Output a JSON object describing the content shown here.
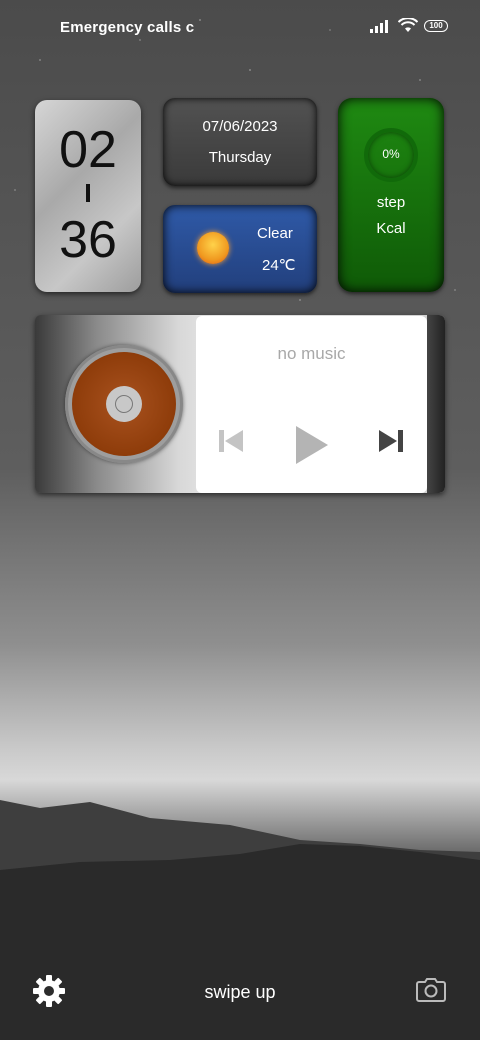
{
  "status_bar": {
    "carrier_text": "Emergency calls c",
    "battery_level": "100",
    "icons": [
      "signal-icon",
      "wifi-icon",
      "battery-icon"
    ]
  },
  "clock_widget": {
    "hours": "02",
    "minutes": "36"
  },
  "date_widget": {
    "date": "07/06/2023",
    "weekday": "Thursday"
  },
  "weather_widget": {
    "condition": "Clear",
    "temperature": "24℃",
    "icon": "sun-icon"
  },
  "fitness_widget": {
    "progress_label": "0%",
    "progress_value": 0,
    "steps_label": "step",
    "calories_label": "Kcal"
  },
  "music_widget": {
    "track_text": "no music",
    "controls": [
      "previous-icon",
      "play-icon",
      "next-icon"
    ]
  },
  "bottom_bar": {
    "left_icon": "settings-icon",
    "hint": "swipe up",
    "right_icon": "camera-icon"
  },
  "colors": {
    "fitness_green": "#1f8a12",
    "weather_blue": "#2f5aa8",
    "disc_orange": "#8e3c0a"
  }
}
